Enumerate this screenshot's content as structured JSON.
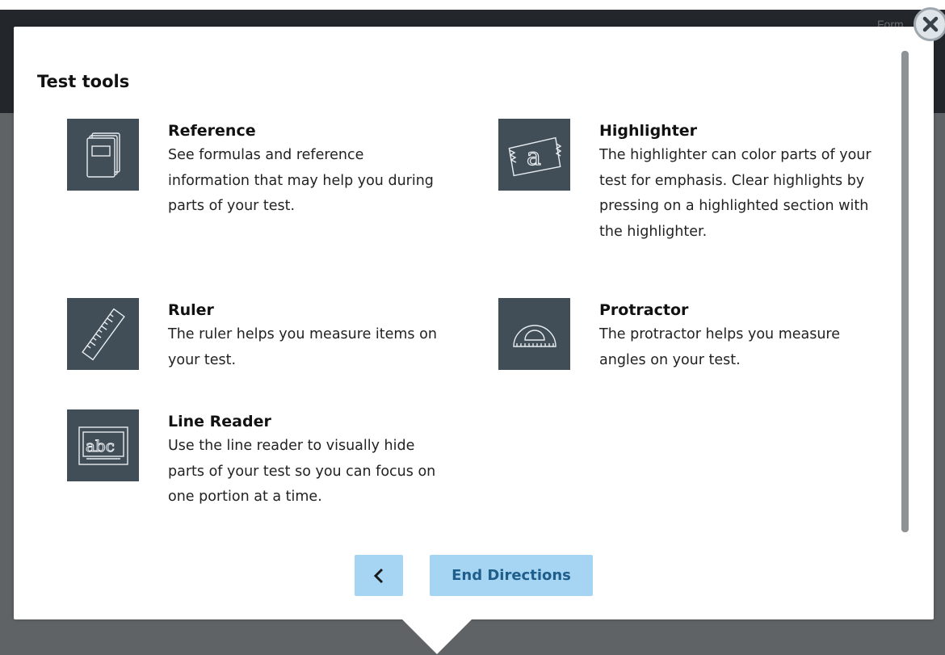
{
  "background": {
    "form_text": "Form"
  },
  "modal": {
    "title": "Test tools",
    "tools": [
      {
        "name": "Reference",
        "description": "See formulas and reference information that may help you during parts of your test.",
        "icon": "reference-book-icon"
      },
      {
        "name": "Highlighter",
        "description": "The highlighter can color parts of your test for emphasis. Clear highlights by pressing on a highlighted section with the highlighter.",
        "icon": "highlighter-icon"
      },
      {
        "name": "Ruler",
        "description": "The ruler helps you measure items on your test.",
        "icon": "ruler-icon"
      },
      {
        "name": "Protractor",
        "description": "The protractor helps you measure angles on your test.",
        "icon": "protractor-icon"
      },
      {
        "name": "Line Reader",
        "description": "Use the line reader to visually hide parts of your test so you can focus on one portion at a time.",
        "icon": "line-reader-icon"
      }
    ],
    "back_button_icon": "chevron-left-icon",
    "end_button_label": "End Directions",
    "close_icon": "close-icon"
  },
  "colors": {
    "icon_tile": "#414d57",
    "button_bg": "#a6d5f4",
    "button_text": "#1f5e8a",
    "overlay": "#5f6366",
    "header": "#23272b"
  }
}
